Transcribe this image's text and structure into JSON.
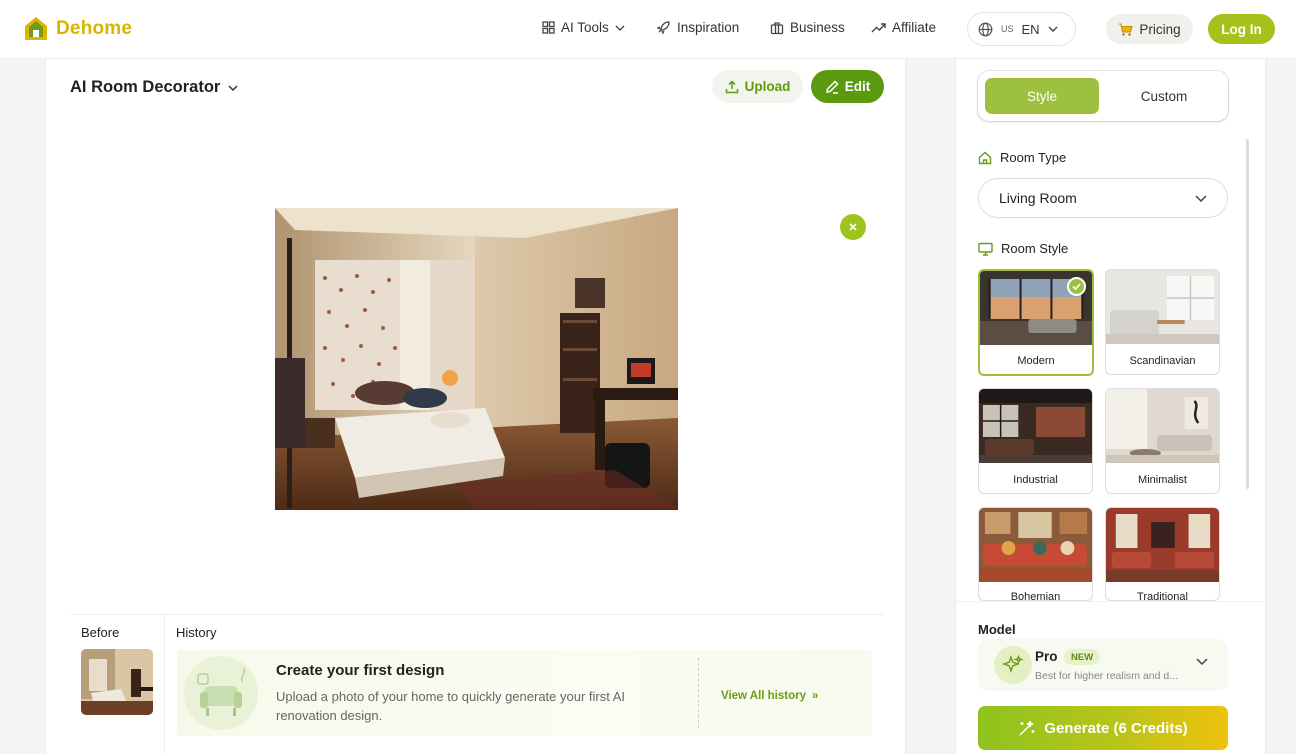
{
  "brand": {
    "name": "Dehome"
  },
  "nav": {
    "items": [
      {
        "label": "AI Tools",
        "icon": "grid-icon"
      },
      {
        "label": "Inspiration",
        "icon": "rocket-icon"
      },
      {
        "label": "Business",
        "icon": "building-icon"
      },
      {
        "label": "Affiliate",
        "icon": "trending-up-icon"
      }
    ],
    "lang": {
      "flag": "US",
      "code": "EN"
    },
    "pricing_label": "Pricing",
    "login_label": "Log In"
  },
  "workspace": {
    "title": "AI Room Decorator",
    "upload_label": "Upload",
    "edit_label": "Edit",
    "before_label": "Before",
    "history_label": "History",
    "history_card": {
      "title": "Create your first design",
      "description": "Upload a photo of your home to quickly generate your first AI renovation design.",
      "link": "View All history",
      "link_arrow": "»"
    }
  },
  "sidebar": {
    "tabs": [
      {
        "label": "Style",
        "active": true
      },
      {
        "label": "Custom",
        "active": false
      }
    ],
    "room_type_label": "Room Type",
    "room_type_value": "Living Room",
    "room_style_label": "Room Style",
    "styles": [
      {
        "name": "Modern",
        "selected": true
      },
      {
        "name": "Scandinavian",
        "selected": false
      },
      {
        "name": "Industrial",
        "selected": false
      },
      {
        "name": "Minimalist",
        "selected": false
      },
      {
        "name": "Bohemian",
        "selected": false
      },
      {
        "name": "Traditional",
        "selected": false
      }
    ],
    "model_label": "Model",
    "model": {
      "name": "Pro",
      "badge": "NEW",
      "description": "Best for higher realism and d..."
    },
    "generate_label": "Generate (6 Credits)"
  },
  "colors": {
    "accent_green": "#9dc040",
    "brand_yellow": "#d8b600",
    "edit_green": "#5a9a10"
  }
}
